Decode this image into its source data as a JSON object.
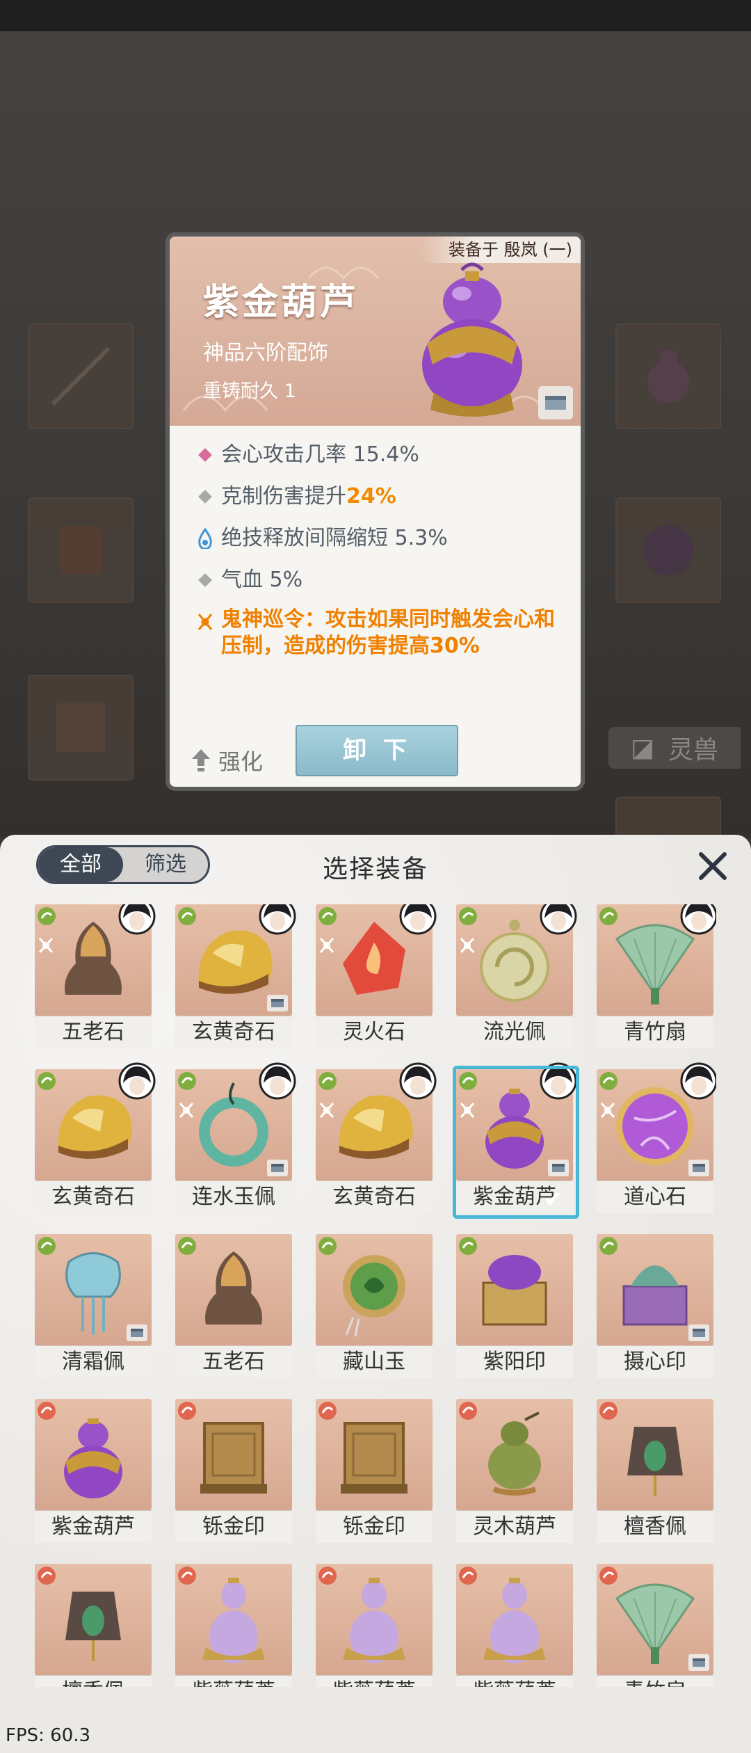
{
  "detail": {
    "equipped_by": "装备于 殷岚 (一)",
    "name": "紫金葫芦",
    "grade": "神品六阶配饰",
    "reforge": "重铸耐久 1",
    "stats": [
      {
        "icon": "pink-diamond-icon",
        "text": "会心攻击几率 15.4%"
      },
      {
        "icon": "gray-diamond-icon",
        "text_before": "克制伤害提升",
        "highlight": "24%"
      },
      {
        "icon": "water-drop-icon",
        "text": "绝技释放间隔缩短 5.3%"
      },
      {
        "icon": "gray-diamond-icon",
        "text": "气血 5%"
      }
    ],
    "special": {
      "icon": "set-knot-icon",
      "line1": "鬼神巡令：攻击如果同时触发会心和",
      "line2": "压制，造成的伤害提高30%"
    },
    "enhance_label": "强化",
    "unequip_label": "卸 下"
  },
  "background": {
    "tab_label": "灵兽"
  },
  "panel": {
    "filter_all": "全部",
    "filter_screen": "筛选",
    "title": "选择装备",
    "close_label": "X"
  },
  "items": [
    {
      "name": "五老石",
      "elem": "#7fae3e",
      "avatar": true,
      "set": true,
      "box": false,
      "art": "stone"
    },
    {
      "name": "玄黄奇石",
      "elem": "#7fae3e",
      "avatar": true,
      "set": false,
      "box": true,
      "art": "gold"
    },
    {
      "name": "灵火石",
      "elem": "#7fae3e",
      "avatar": true,
      "set": true,
      "box": false,
      "art": "fire"
    },
    {
      "name": "流光佩",
      "elem": "#7fae3e",
      "avatar": true,
      "set": true,
      "box": false,
      "art": "disc"
    },
    {
      "name": "青竹扇",
      "elem": "#7fae3e",
      "avatar": true,
      "set": false,
      "box": false,
      "art": "fan"
    },
    {
      "name": "玄黄奇石",
      "elem": "#7fae3e",
      "avatar": true,
      "set": false,
      "box": false,
      "art": "gold"
    },
    {
      "name": "连水玉佩",
      "elem": "#7fae3e",
      "avatar": true,
      "set": true,
      "box": true,
      "art": "ring"
    },
    {
      "name": "玄黄奇石",
      "elem": "#7fae3e",
      "avatar": true,
      "set": true,
      "box": false,
      "art": "gold"
    },
    {
      "name": "紫金葫芦",
      "elem": "#7fae3e",
      "avatar": true,
      "set": true,
      "box": true,
      "art": "gourd",
      "selected": true
    },
    {
      "name": "道心石",
      "elem": "#7fae3e",
      "avatar": true,
      "set": true,
      "box": true,
      "art": "orb"
    },
    {
      "name": "清霜佩",
      "elem": "#7fae3e",
      "avatar": false,
      "set": false,
      "box": true,
      "art": "frost"
    },
    {
      "name": "五老石",
      "elem": "#7fae3e",
      "avatar": false,
      "set": false,
      "box": false,
      "art": "stone"
    },
    {
      "name": "藏山玉",
      "elem": "#7fae3e",
      "avatar": false,
      "set": false,
      "box": false,
      "art": "jade"
    },
    {
      "name": "紫阳印",
      "elem": "#7fae3e",
      "avatar": false,
      "set": false,
      "box": false,
      "art": "seal-purple"
    },
    {
      "name": "摄心印",
      "elem": "#7fae3e",
      "avatar": false,
      "set": false,
      "box": true,
      "art": "seal-green"
    },
    {
      "name": "紫金葫芦",
      "elem": "#e0664f",
      "avatar": false,
      "set": false,
      "box": false,
      "art": "gourd"
    },
    {
      "name": "铄金印",
      "elem": "#e0664f",
      "avatar": false,
      "set": false,
      "box": false,
      "art": "seal-gold"
    },
    {
      "name": "铄金印",
      "elem": "#e0664f",
      "avatar": false,
      "set": false,
      "box": false,
      "art": "seal-gold"
    },
    {
      "name": "灵木葫芦",
      "elem": "#e0664f",
      "avatar": false,
      "set": false,
      "box": false,
      "art": "wood"
    },
    {
      "name": "檀香佩",
      "elem": "#e0664f",
      "avatar": false,
      "set": false,
      "box": false,
      "art": "sandal"
    },
    {
      "name": "檀香佩",
      "elem": "#e0664f",
      "avatar": false,
      "set": false,
      "box": false,
      "art": "sandal"
    },
    {
      "name": "紫薇葫芦",
      "elem": "#e0664f",
      "avatar": false,
      "set": false,
      "box": false,
      "art": "vase"
    },
    {
      "name": "紫薇葫芦",
      "elem": "#e0664f",
      "avatar": false,
      "set": false,
      "box": false,
      "art": "vase"
    },
    {
      "name": "紫薇葫芦",
      "elem": "#e0664f",
      "avatar": false,
      "set": false,
      "box": false,
      "art": "vase"
    },
    {
      "name": "青竹扇",
      "elem": "#e0664f",
      "avatar": false,
      "set": false,
      "box": true,
      "art": "fan"
    }
  ],
  "fps": "FPS: 60.3"
}
